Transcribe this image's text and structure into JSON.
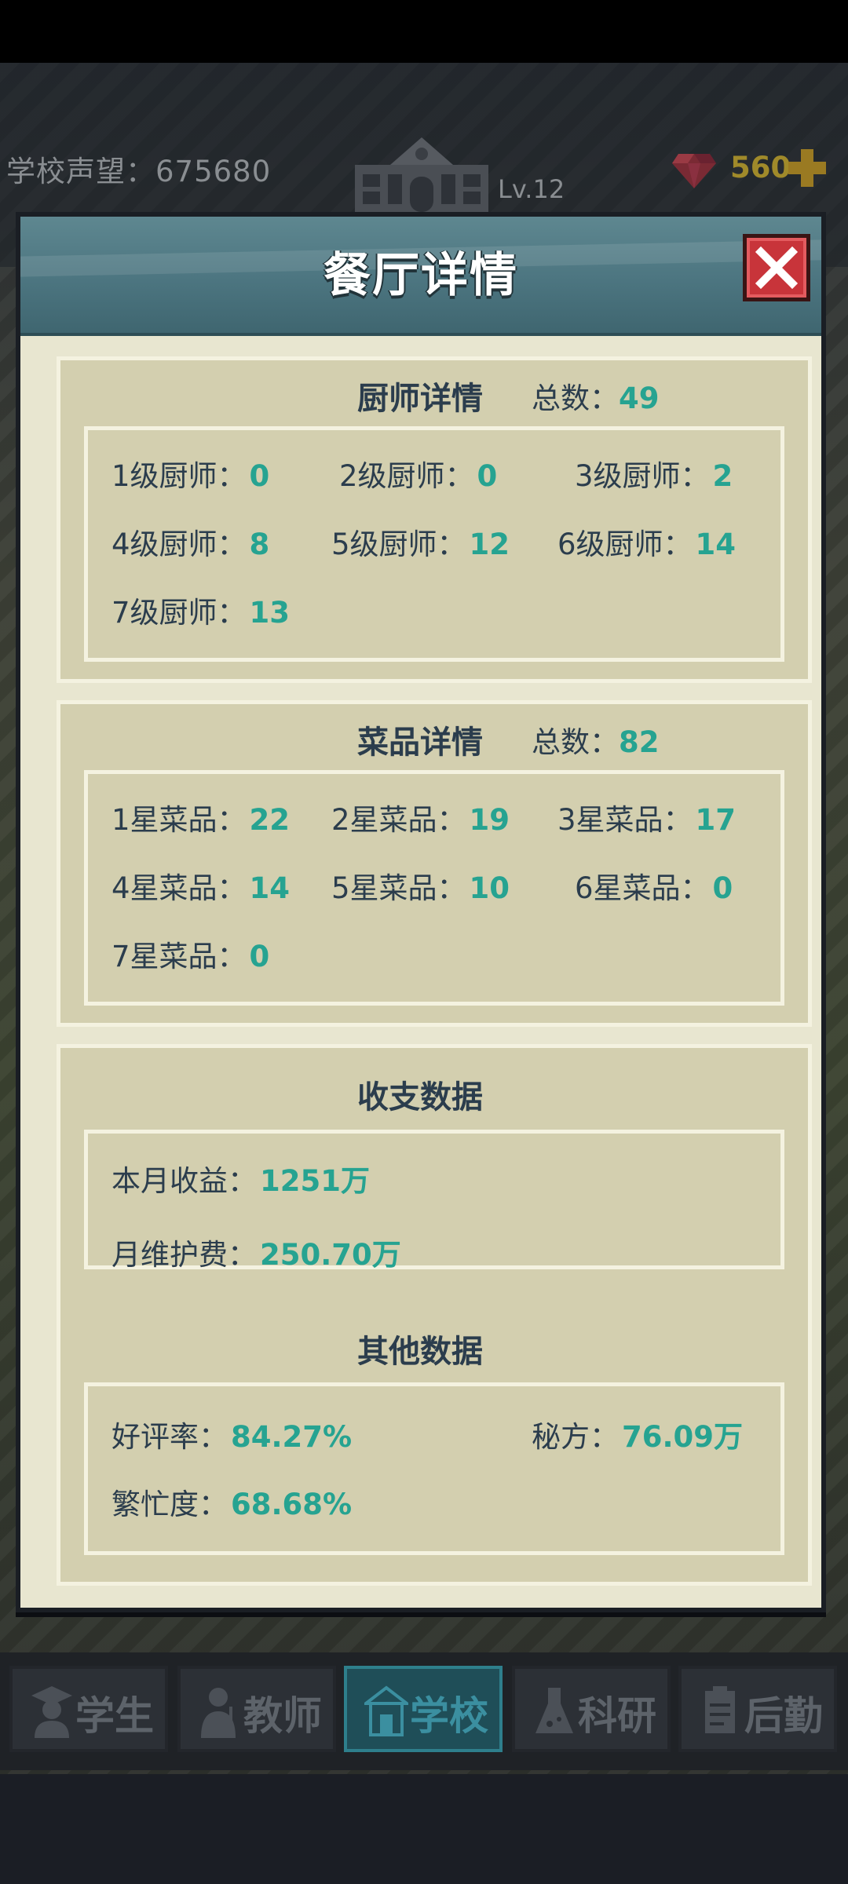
{
  "hud": {
    "prestige_label": "学校声望：675680",
    "level": "Lv.12",
    "gem_count": "560"
  },
  "modal": {
    "title": "餐厅详情",
    "chefs": {
      "title": "厨师详情",
      "total_label": "总数：",
      "total_value": "49",
      "items": [
        {
          "label": "1级厨师：",
          "value": "0"
        },
        {
          "label": "2级厨师：",
          "value": "0"
        },
        {
          "label": "3级厨师：",
          "value": "2"
        },
        {
          "label": "4级厨师：",
          "value": "8"
        },
        {
          "label": "5级厨师：",
          "value": "12"
        },
        {
          "label": "6级厨师：",
          "value": "14"
        },
        {
          "label": "7级厨师：",
          "value": "13"
        }
      ]
    },
    "dishes": {
      "title": "菜品详情",
      "total_label": "总数：",
      "total_value": "82",
      "items": [
        {
          "label": "1星菜品：",
          "value": "22"
        },
        {
          "label": "2星菜品：",
          "value": "19"
        },
        {
          "label": "3星菜品：",
          "value": "17"
        },
        {
          "label": "4星菜品：",
          "value": "14"
        },
        {
          "label": "5星菜品：",
          "value": "10"
        },
        {
          "label": "6星菜品：",
          "value": "0"
        },
        {
          "label": "7星菜品：",
          "value": "0"
        }
      ]
    },
    "finance": {
      "title": "收支数据",
      "income_label": "本月收益：",
      "income_value": "1251万",
      "maintenance_label": "月维护费：",
      "maintenance_value": "250.70万"
    },
    "other": {
      "title": "其他数据",
      "rating_label": "好评率：",
      "rating_value": "84.27%",
      "recipe_label": "秘方：",
      "recipe_value": "76.09万",
      "busy_label": "繁忙度：",
      "busy_value": "68.68%"
    }
  },
  "nav": {
    "tabs": [
      {
        "label": "学生",
        "icon": "student-icon"
      },
      {
        "label": "教师",
        "icon": "teacher-icon"
      },
      {
        "label": "学校",
        "icon": "school-icon",
        "active": true
      },
      {
        "label": "科研",
        "icon": "research-icon"
      },
      {
        "label": "后勤",
        "icon": "logistics-icon"
      }
    ]
  },
  "colors": {
    "accent_value": "#26a391",
    "header_teal": "#4c7580",
    "close_red": "#c8343a",
    "panel_bg": "#d3cfaf"
  }
}
